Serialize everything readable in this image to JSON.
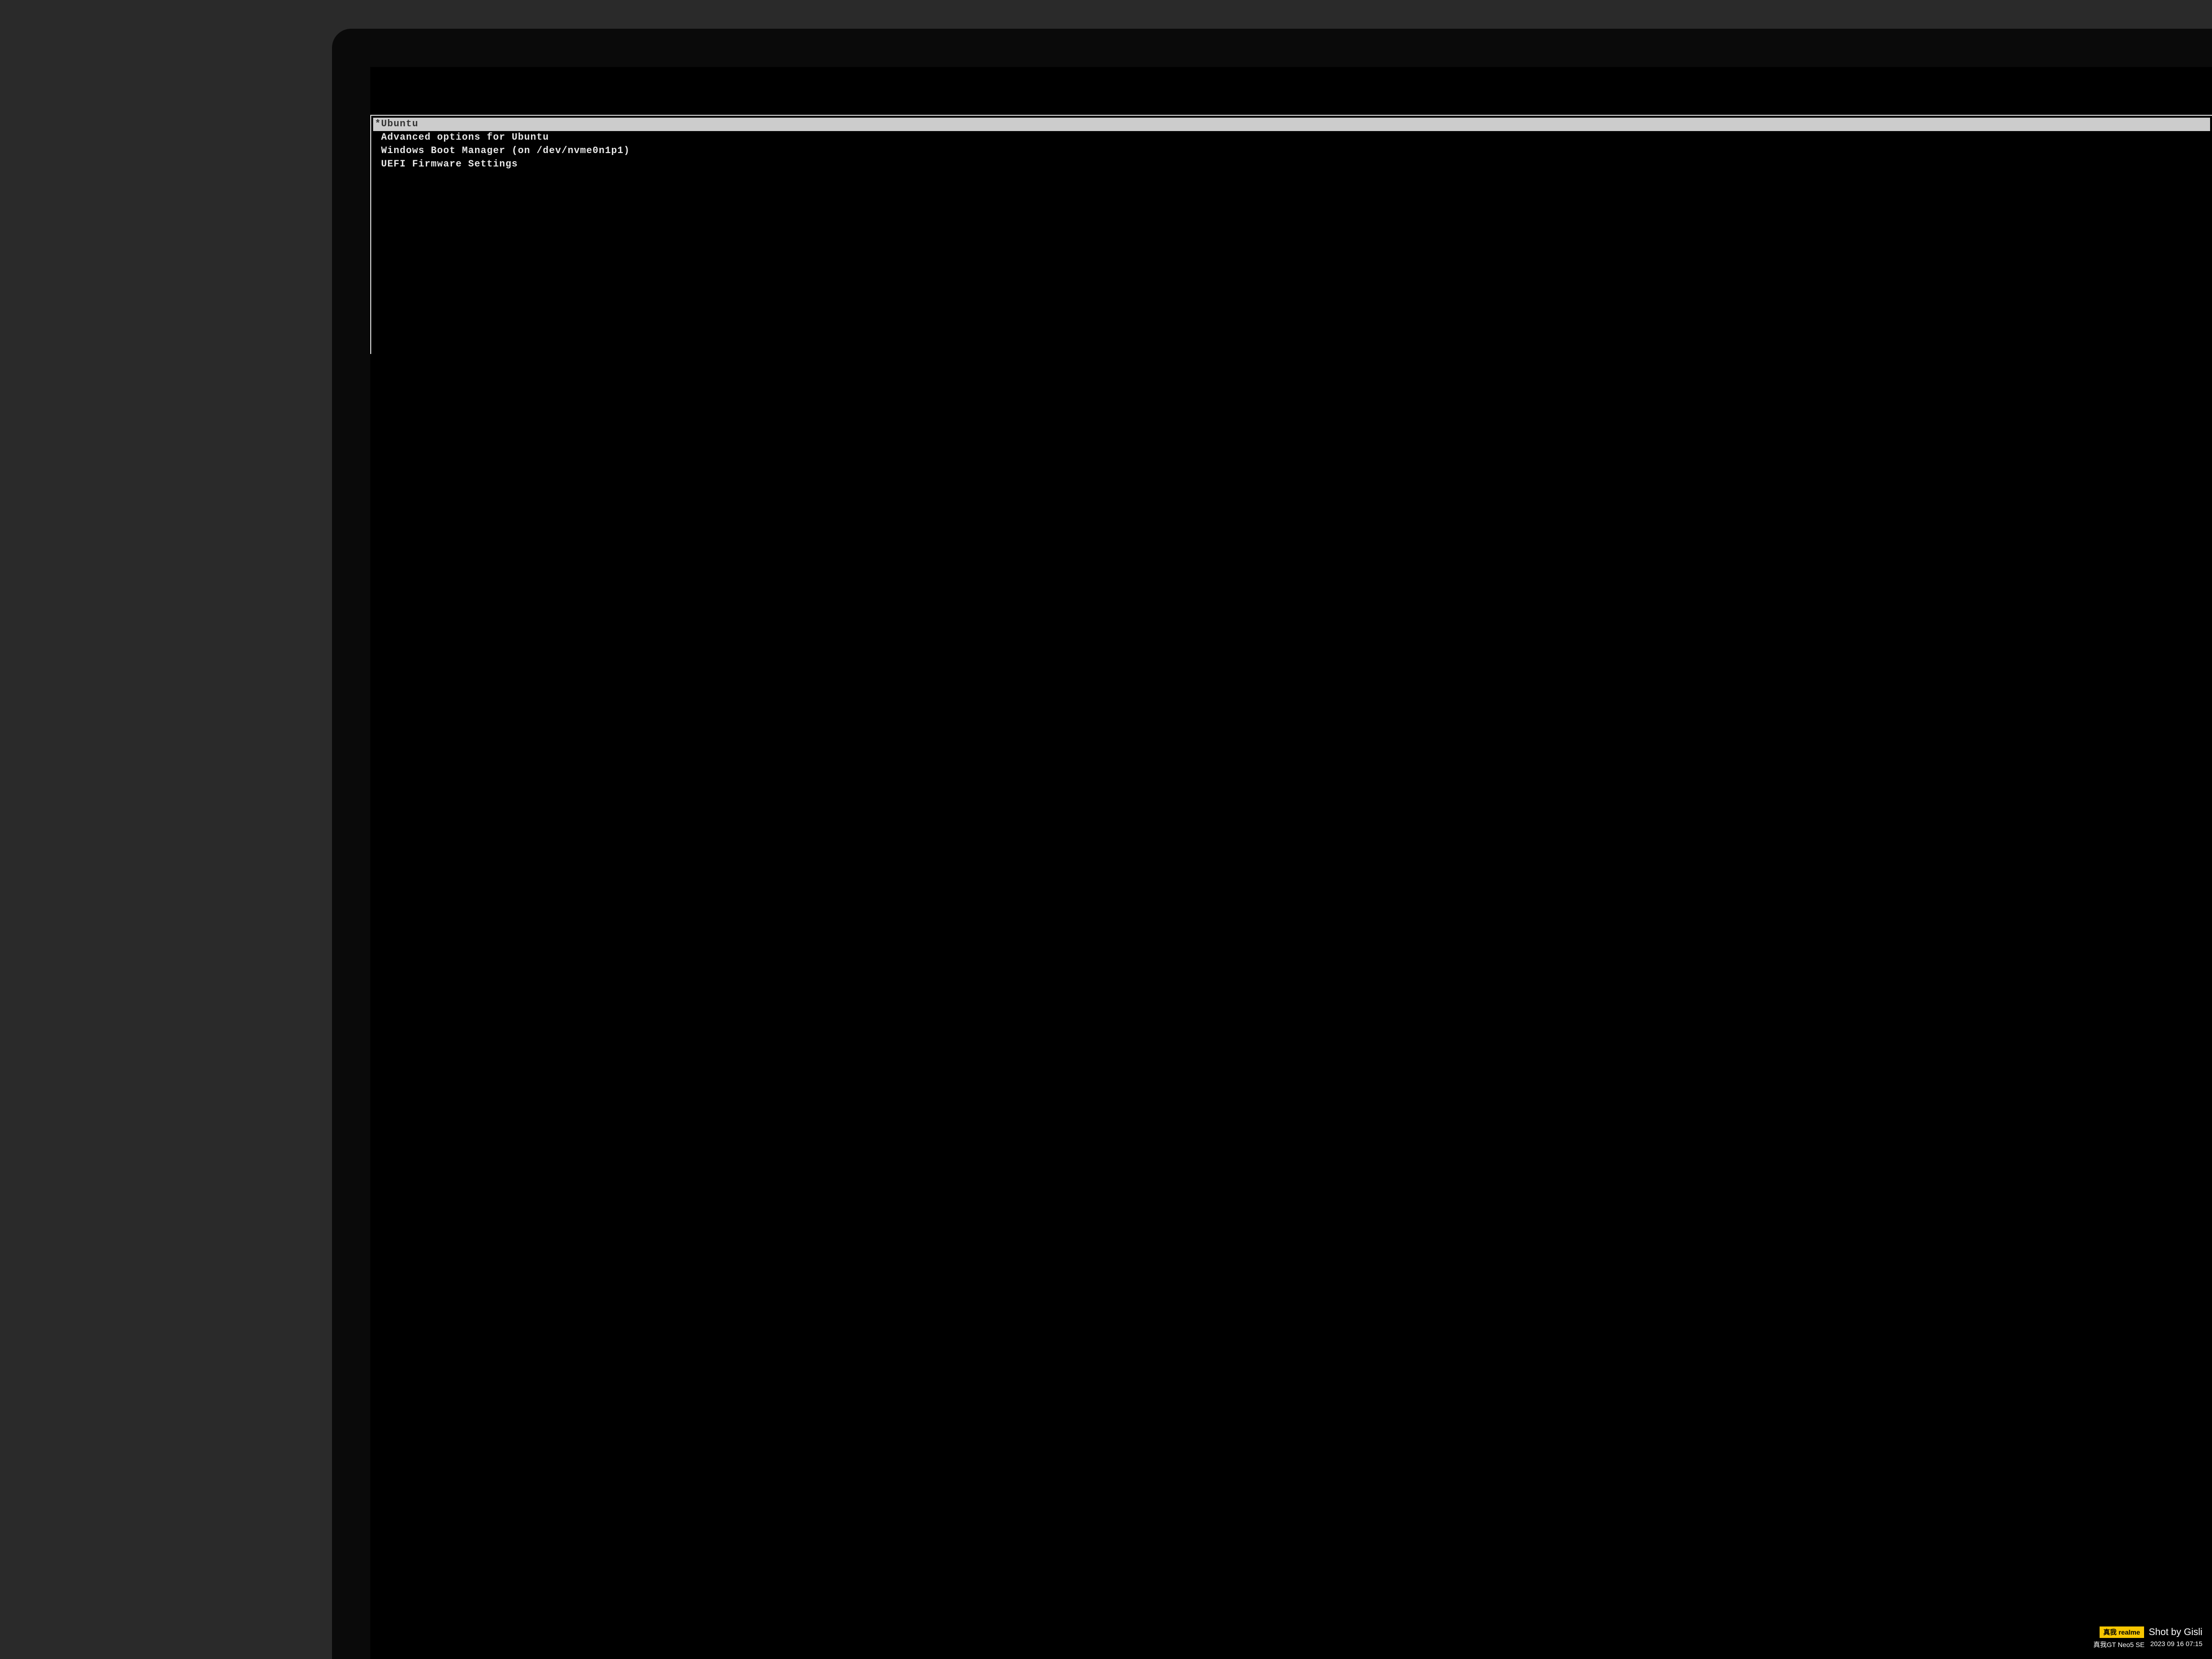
{
  "grub": {
    "menu_items": [
      {
        "label": "*Ubuntu",
        "selected": true
      },
      {
        "label": " Advanced options for Ubuntu",
        "selected": false
      },
      {
        "label": " Windows Boot Manager (on /dev/nvme0n1p1)",
        "selected": false
      },
      {
        "label": " UEFI Firmware Settings",
        "selected": false
      }
    ]
  },
  "watermark": {
    "badge_cn": "真我",
    "badge_en": "realme",
    "shot_by": "Shot by Gisli",
    "device": "真我GT Neo5 SE",
    "timestamp": "2023 09 16 07:15"
  }
}
